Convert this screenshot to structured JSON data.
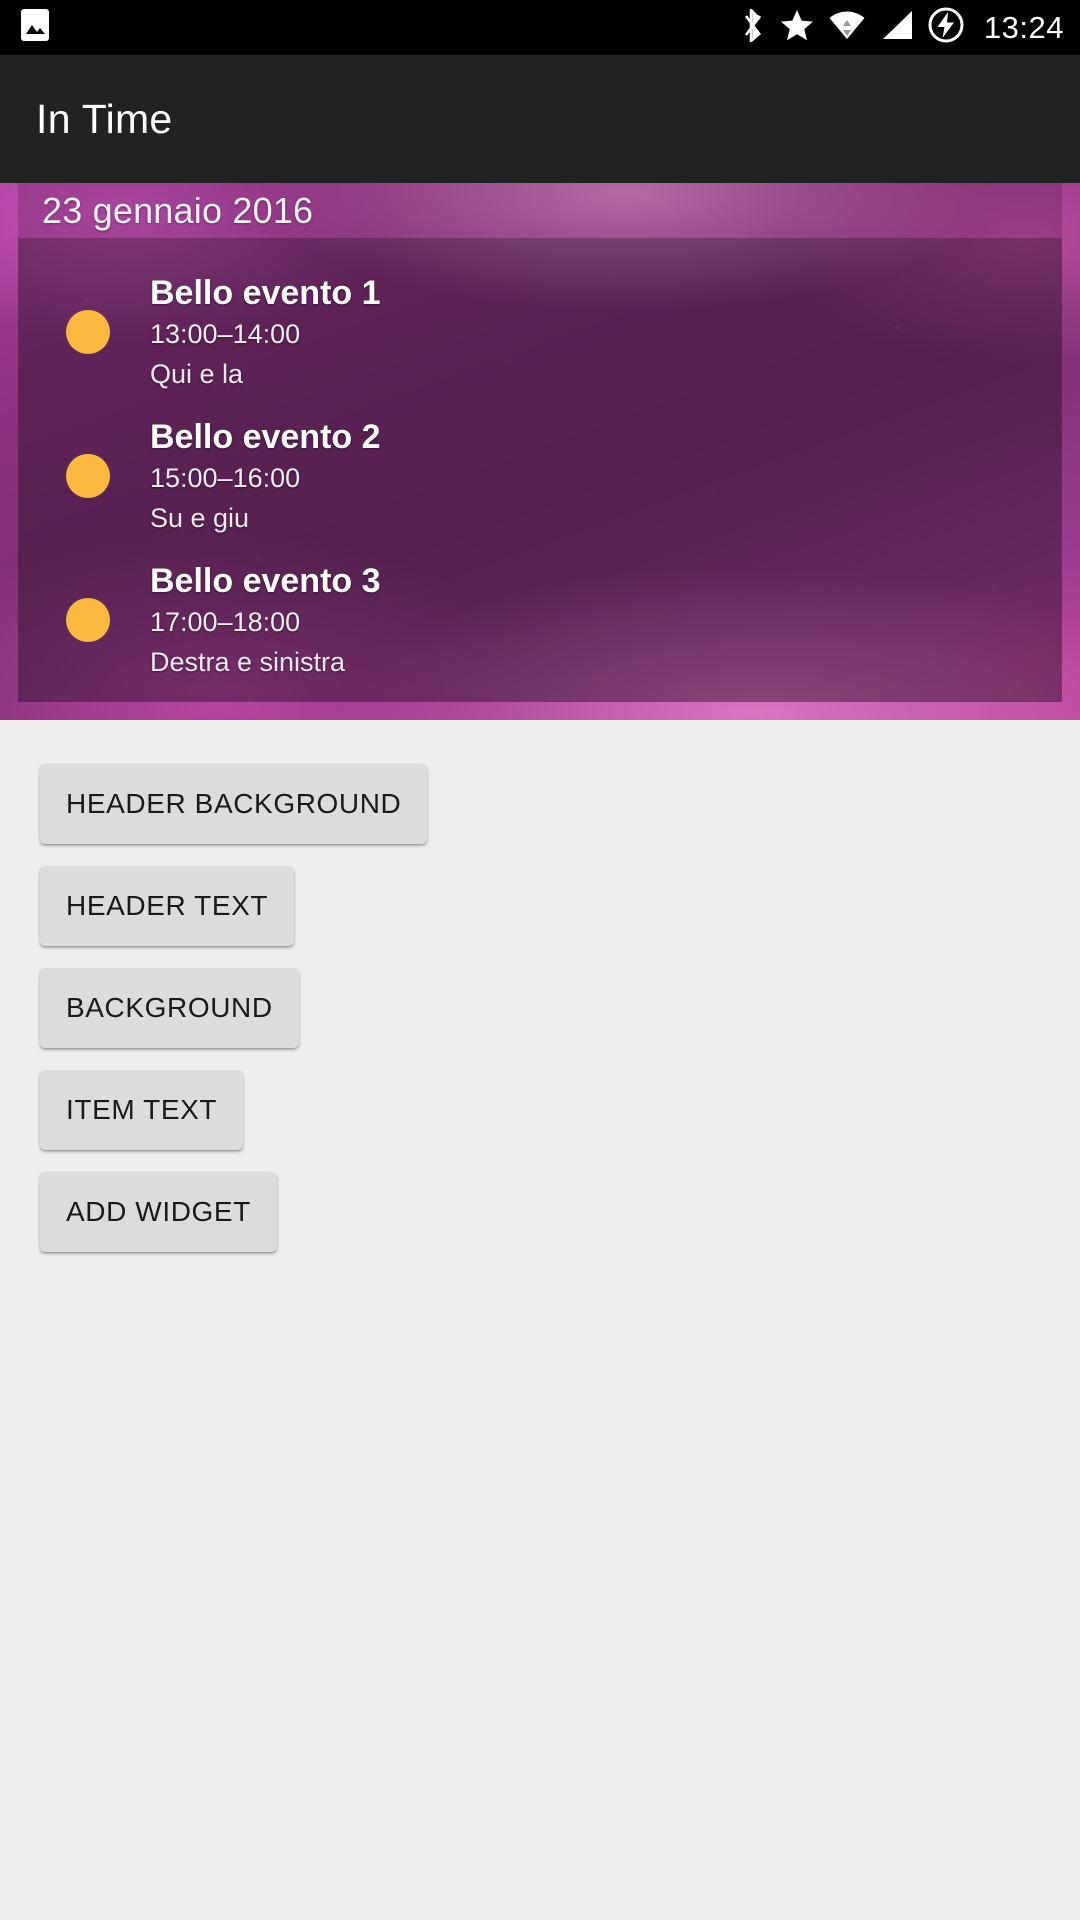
{
  "statusbar": {
    "time": "13:24",
    "icons": [
      {
        "name": "gallery-image-icon",
        "side": "left"
      },
      {
        "name": "bluetooth-icon",
        "side": "right"
      },
      {
        "name": "star-icon",
        "side": "right"
      },
      {
        "name": "wifi-icon",
        "side": "right"
      },
      {
        "name": "cellular-signal-icon",
        "side": "right"
      },
      {
        "name": "battery-charging-icon",
        "side": "right"
      }
    ],
    "background_color": "#000000",
    "icon_color": "#ffffff"
  },
  "appbar": {
    "title": "In Time",
    "background_color": "#222222",
    "text_color": "#ffffff"
  },
  "widget_preview": {
    "header_date": "23 gennaio 2016",
    "accent_dot_color": "#fbb93f",
    "header_text_color": "#f4f0f3",
    "item_text_color": "#ffffff",
    "events": [
      {
        "title": "Bello evento 1",
        "time": "13:00–14:00",
        "place": "Qui e la"
      },
      {
        "title": "Bello evento 2",
        "time": "15:00–16:00",
        "place": "Su e giu"
      },
      {
        "title": "Bello evento 3",
        "time": "17:00–18:00",
        "place": "Destra e sinistra"
      }
    ]
  },
  "controls": {
    "buttons": [
      {
        "label": "HEADER BACKGROUND"
      },
      {
        "label": "HEADER TEXT"
      },
      {
        "label": "BACKGROUND"
      },
      {
        "label": "ITEM TEXT"
      },
      {
        "label": "ADD WIDGET"
      }
    ],
    "button_color": "#dcdcdc",
    "button_text_color": "#1a1a1a"
  },
  "page": {
    "background_color": "#eeeeee"
  }
}
